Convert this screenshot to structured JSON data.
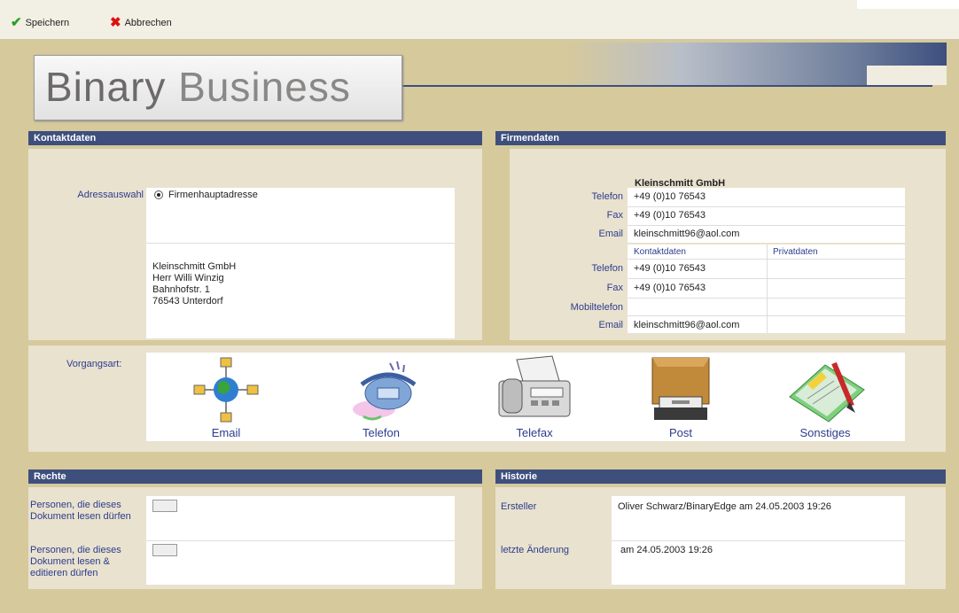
{
  "toolbar": {
    "save_label": "Speichern",
    "cancel_label": "Abbrechen"
  },
  "logo": {
    "word1": "Binary",
    "word2": "Business"
  },
  "kontakt": {
    "title": "Kontaktdaten",
    "adress_label": "Adressauswahl",
    "adress_option": "Firmenhauptadresse",
    "address_lines": [
      "Kleinschmitt GmbH",
      "Herr Willi Winzig",
      "Bahnhofstr. 1",
      "76543   Unterdorf"
    ]
  },
  "firma": {
    "title": "Firmendaten",
    "company_name": "Kleinschmitt GmbH",
    "telefon_label": "Telefon",
    "telefon": "+49 (0)10 76543",
    "fax_label": "Fax",
    "fax": "+49 (0)10 76543",
    "email_label": "Email",
    "email": "kleinschmitt96@aol.com",
    "col_kontakt": "Kontaktdaten",
    "col_privat": "Privatdaten",
    "k_telefon_label": "Telefon",
    "k_telefon": "+49 (0)10 76543",
    "k_fax_label": "Fax",
    "k_fax": "+49 (0)10 76543",
    "k_mobil_label": "Mobiltelefon",
    "k_email_label": "Email",
    "k_email": "kleinschmitt96@aol.com"
  },
  "vorgang": {
    "label": "Vorgangsart:",
    "items": [
      "Email",
      "Telefon",
      "Telefax",
      "Post",
      "Sonstiges"
    ]
  },
  "rechte": {
    "title": "Rechte",
    "read_label": "Personen, die dieses Dokument lesen dürfen",
    "edit_label": "Personen, die dieses Dokument lesen & editieren  dürfen"
  },
  "historie": {
    "title": "Historie",
    "ersteller_label": "Ersteller",
    "ersteller": "Oliver Schwarz/BinaryEdge am 24.05.2003 19:26",
    "aenderung_label": "letzte Änderung",
    "aenderung": "am 24.05.2003 19:26"
  },
  "colors": {
    "background": "#d6c99c",
    "panel": "#e9e2cf",
    "header": "#3e4f7e",
    "label": "#2c3c8c"
  },
  "icons": {
    "save": "checkmark-icon",
    "cancel": "x-icon",
    "email": "globe-network-icon",
    "telefon": "telephone-icon",
    "telefax": "fax-machine-icon",
    "post": "mailbox-icon",
    "sonstiges": "notepad-pencil-icon"
  }
}
